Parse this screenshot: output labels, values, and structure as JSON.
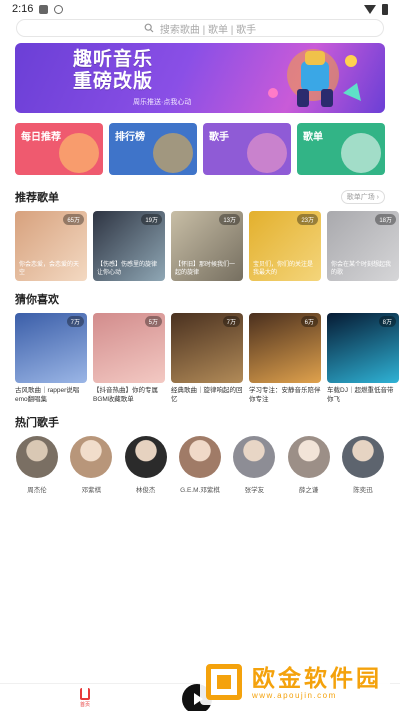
{
  "status_bar": {
    "time": "2:16"
  },
  "search": {
    "placeholder": "搜索歌曲 | 歌单 | 歌手"
  },
  "banner": {
    "title_line1": "趣听音乐",
    "title_line2": "重磅改版",
    "subtitle": "周乐推送·点我心动"
  },
  "categories": [
    {
      "label": "每日推荐",
      "color": "#ef5a6f"
    },
    {
      "label": "排行榜",
      "color": "#3f74c9"
    },
    {
      "label": "歌手",
      "color": "#8f5bd6"
    },
    {
      "label": "歌单",
      "color": "#32b486"
    }
  ],
  "recommended_playlists": {
    "title": "推荐歌单",
    "more_label": "歌单广场 ›",
    "items": [
      {
        "plays": "65万",
        "overlay": "你会恋爱，会恋爱的天空",
        "color_a": "#d7a17d",
        "color_b": "#f3d9c2"
      },
      {
        "plays": "19万",
        "overlay": "【伤感】伤感里的旋律让你心动",
        "color_a": "#2e3442",
        "color_b": "#8fa7b5"
      },
      {
        "plays": "13万",
        "overlay": "【怀旧】那时候我们一起的旋律",
        "color_a": "#c8bea6",
        "color_b": "#766f60"
      },
      {
        "plays": "23万",
        "overlay": "宝贝们，你们的关注是我最大的",
        "color_a": "#e3b02d",
        "color_b": "#f4d57b"
      },
      {
        "plays": "18万",
        "overlay": "你会在某个时刻想起我的歌",
        "color_a": "#a9a9ad",
        "color_b": "#d6d6d8"
      }
    ]
  },
  "guess_you_like": {
    "title": "猜你喜欢",
    "items": [
      {
        "plays": "7万",
        "text": "古风歌曲｜rapper说唱emo翻唱集",
        "color_a": "#3b5ea8",
        "color_b": "#9bb6e6"
      },
      {
        "plays": "5万",
        "text": "【抖音热曲】你的专属BGM收藏歌单",
        "color_a": "#d28c8c",
        "color_b": "#f3c9c3"
      },
      {
        "plays": "7万",
        "text": "经典歌曲｜旋律响起的回忆",
        "color_a": "#4a3120",
        "color_b": "#b28b58"
      },
      {
        "plays": "6万",
        "text": "学习专注：安静音乐陪伴你专注",
        "color_a": "#4a2f1e",
        "color_b": "#e0a24d"
      },
      {
        "plays": "8万",
        "text": "车载DJ｜超燃重低音带你飞",
        "color_a": "#061a33",
        "color_b": "#2fb3d6"
      }
    ]
  },
  "hot_artists": {
    "title": "热门歌手",
    "items": [
      {
        "name": "周杰伦",
        "color": "#7a6f63"
      },
      {
        "name": "邓紫棋",
        "color": "#b8967a"
      },
      {
        "name": "林俊杰",
        "color": "#2b2b2b"
      },
      {
        "name": "G.E.M.邓紫棋",
        "color": "#a07b67"
      },
      {
        "name": "张学友",
        "color": "#8d8d95"
      },
      {
        "name": "薛之谦",
        "color": "#9c8f87"
      },
      {
        "name": "陈奕迅",
        "color": "#5d646e"
      }
    ]
  },
  "bottom_nav": {
    "home_label": "首页"
  },
  "watermark": {
    "title": "欧金软件园",
    "url": "www.apoujin.com"
  }
}
